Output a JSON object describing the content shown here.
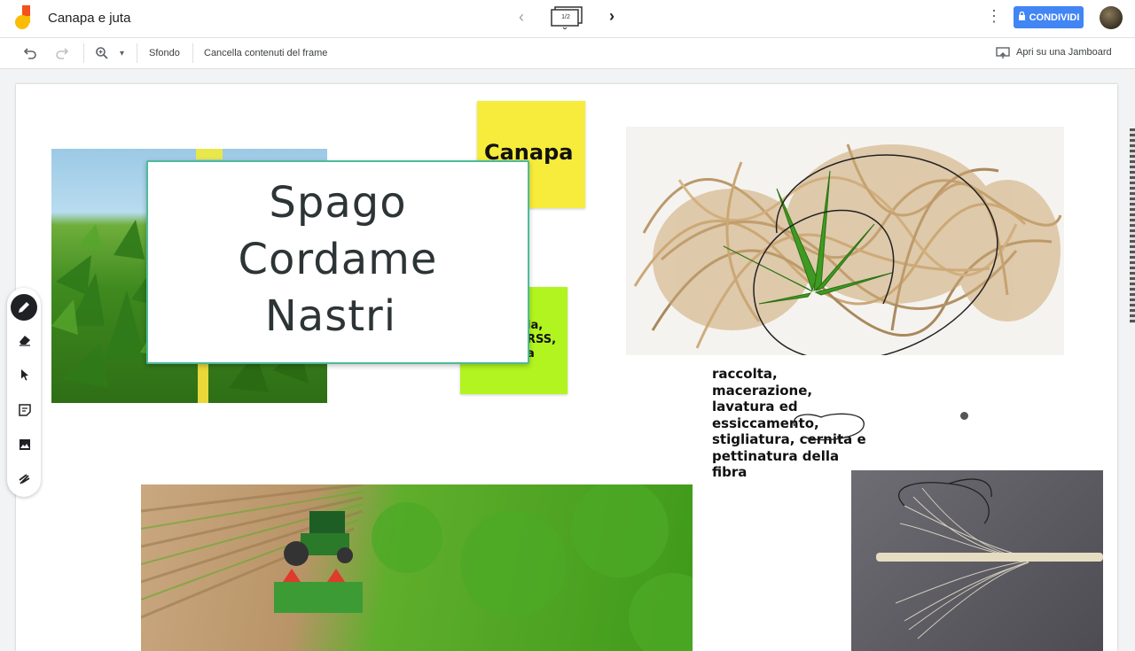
{
  "app": {
    "doc_title": "Canapa e juta",
    "frame_counter": "1/2",
    "share_label": "CONDIVIDI"
  },
  "toolbar": {
    "background_label": "Sfondo",
    "clear_frame_label": "Cancella contenuti del frame",
    "open_in_jamboard_label": "Apri su una Jamboard"
  },
  "board": {
    "main_card_lines": [
      "Spago",
      "Cordame",
      "Nastri"
    ],
    "yellow_sticky": "Canapa",
    "green_sticky_lines": [
      "ia,",
      "RSS,",
      "a"
    ],
    "fiber_text_lines": [
      "raccolta,",
      "macerazione,",
      "lavatura ed",
      "essiccamento,",
      "stigliatura, cernita e",
      "pettinatura della",
      "fibra"
    ]
  },
  "colors": {
    "accent_blue": "#4285f4",
    "yellow_sticky": "#f7ec3b",
    "green_sticky": "#b2f41f",
    "card_border": "#4dbb9b"
  },
  "icons": [
    "jamboard-logo",
    "chevron-left-icon",
    "frames-icon",
    "chevron-right-icon",
    "more-vert-icon",
    "lock-icon",
    "undo-icon",
    "redo-icon",
    "zoom-icon",
    "dropdown-icon",
    "present-icon",
    "pen-icon",
    "eraser-icon",
    "select-icon",
    "sticky-note-icon",
    "image-icon",
    "laser-icon"
  ]
}
